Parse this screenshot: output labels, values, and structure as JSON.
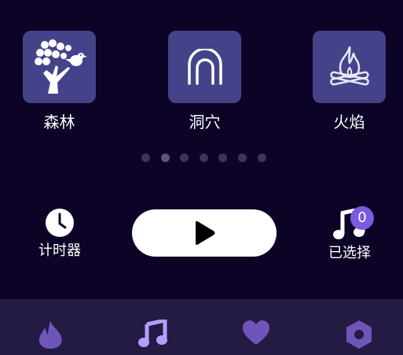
{
  "sounds": [
    {
      "label": "森林",
      "icon": "tree-bird-icon"
    },
    {
      "label": "洞穴",
      "icon": "cave-arch-icon"
    },
    {
      "label": "火焰",
      "icon": "campfire-icon"
    }
  ],
  "pager": {
    "count": 7,
    "active_index": 1
  },
  "controls": {
    "timer_label": "计时器",
    "timer_icon": "clock-icon",
    "play_icon": "play-icon",
    "selected_label": "已选择",
    "selected_count": "0",
    "selected_icon": "music-note-icon"
  },
  "bottom_nav": [
    {
      "name": "fire",
      "icon": "flame-icon",
      "active": false
    },
    {
      "name": "music",
      "icon": "music-note-icon",
      "active": true
    },
    {
      "name": "favorites",
      "icon": "heart-icon",
      "active": false
    },
    {
      "name": "settings",
      "icon": "hexagon-settings-icon",
      "active": false
    }
  ],
  "colors": {
    "background": "#0d0326",
    "tile": "#44438a",
    "nav_bar": "#241b44",
    "nav_icon": "#6f55b8",
    "nav_icon_active": "#b79cff",
    "badge": "#7a5be0"
  }
}
